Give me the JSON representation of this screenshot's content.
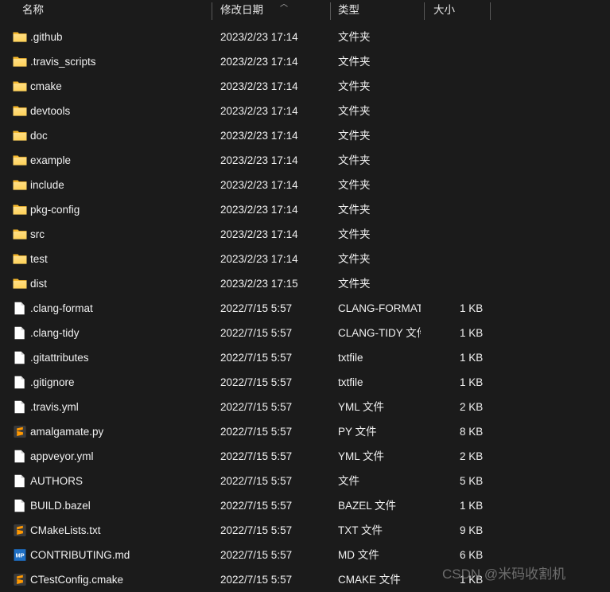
{
  "header": {
    "columns": [
      {
        "key": "name",
        "label": "名称"
      },
      {
        "key": "date",
        "label": "修改日期"
      },
      {
        "key": "type",
        "label": "类型"
      },
      {
        "key": "size",
        "label": "大小"
      }
    ],
    "sort_column": "修改日期",
    "sort_direction": "ascending",
    "sort_arrow_glyph": "︿"
  },
  "colors": {
    "background": "#1b1b1b",
    "text": "#f0f0f0",
    "header_text": "#e6e6e6",
    "divider": "#585858",
    "folder_light": "#ffe08a",
    "folder_mid": "#ffd35c",
    "folder_tab": "#f5b82e",
    "doc_white": "#ffffff",
    "sublime_bg": "#3b3b3b",
    "sublime_orange": "#ff9800",
    "markdownpad_bg": "#1e6fc4",
    "watermark": "#8c8c8c"
  },
  "rows": [
    {
      "icon": "folder-icon",
      "name": ".github",
      "date": "2023/2/23 17:14",
      "type": "文件夹",
      "size": ""
    },
    {
      "icon": "folder-icon",
      "name": ".travis_scripts",
      "date": "2023/2/23 17:14",
      "type": "文件夹",
      "size": ""
    },
    {
      "icon": "folder-icon",
      "name": "cmake",
      "date": "2023/2/23 17:14",
      "type": "文件夹",
      "size": ""
    },
    {
      "icon": "folder-icon",
      "name": "devtools",
      "date": "2023/2/23 17:14",
      "type": "文件夹",
      "size": ""
    },
    {
      "icon": "folder-icon",
      "name": "doc",
      "date": "2023/2/23 17:14",
      "type": "文件夹",
      "size": ""
    },
    {
      "icon": "folder-icon",
      "name": "example",
      "date": "2023/2/23 17:14",
      "type": "文件夹",
      "size": ""
    },
    {
      "icon": "folder-icon",
      "name": "include",
      "date": "2023/2/23 17:14",
      "type": "文件夹",
      "size": ""
    },
    {
      "icon": "folder-icon",
      "name": "pkg-config",
      "date": "2023/2/23 17:14",
      "type": "文件夹",
      "size": ""
    },
    {
      "icon": "folder-icon",
      "name": "src",
      "date": "2023/2/23 17:14",
      "type": "文件夹",
      "size": ""
    },
    {
      "icon": "folder-icon",
      "name": "test",
      "date": "2023/2/23 17:14",
      "type": "文件夹",
      "size": ""
    },
    {
      "icon": "folder-icon",
      "name": "dist",
      "date": "2023/2/23 17:15",
      "type": "文件夹",
      "size": ""
    },
    {
      "icon": "document-icon",
      "name": ".clang-format",
      "date": "2022/7/15 5:57",
      "type": "CLANG-FORMAT...",
      "size": "1 KB"
    },
    {
      "icon": "document-icon",
      "name": ".clang-tidy",
      "date": "2022/7/15 5:57",
      "type": "CLANG-TIDY 文件",
      "size": "1 KB"
    },
    {
      "icon": "document-icon",
      "name": ".gitattributes",
      "date": "2022/7/15 5:57",
      "type": "txtfile",
      "size": "1 KB"
    },
    {
      "icon": "document-icon",
      "name": ".gitignore",
      "date": "2022/7/15 5:57",
      "type": "txtfile",
      "size": "1 KB"
    },
    {
      "icon": "document-icon",
      "name": ".travis.yml",
      "date": "2022/7/15 5:57",
      "type": "YML 文件",
      "size": "2 KB"
    },
    {
      "icon": "sublime-text-icon",
      "name": "amalgamate.py",
      "date": "2022/7/15 5:57",
      "type": "PY 文件",
      "size": "8 KB"
    },
    {
      "icon": "document-icon",
      "name": "appveyor.yml",
      "date": "2022/7/15 5:57",
      "type": "YML 文件",
      "size": "2 KB"
    },
    {
      "icon": "document-icon",
      "name": "AUTHORS",
      "date": "2022/7/15 5:57",
      "type": "文件",
      "size": "5 KB"
    },
    {
      "icon": "document-icon",
      "name": "BUILD.bazel",
      "date": "2022/7/15 5:57",
      "type": "BAZEL 文件",
      "size": "1 KB"
    },
    {
      "icon": "sublime-text-icon",
      "name": "CMakeLists.txt",
      "date": "2022/7/15 5:57",
      "type": "TXT 文件",
      "size": "9 KB"
    },
    {
      "icon": "markdownpad-icon",
      "name": "CONTRIBUTING.md",
      "date": "2022/7/15 5:57",
      "type": "MD 文件",
      "size": "6 KB"
    },
    {
      "icon": "sublime-text-icon",
      "name": "CTestConfig.cmake",
      "date": "2022/7/15 5:57",
      "type": "CMAKE 文件",
      "size": "1 KB"
    }
  ],
  "watermark": {
    "text": "CSDN @米码收割机"
  }
}
